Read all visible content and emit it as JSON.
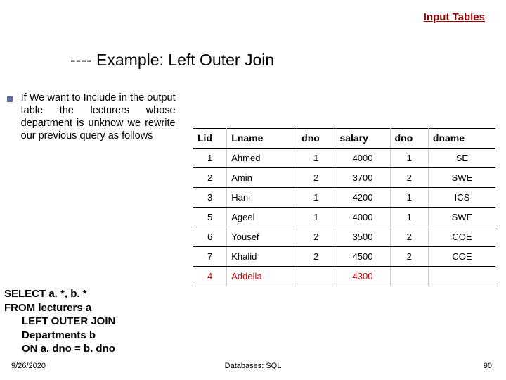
{
  "link": "Input Tables",
  "title": "---- Example: Left Outer Join",
  "bullet": "If We want to Include in the output table the lecturers whose department is unknow we rewrite our previous query as follows",
  "sql": "SELECT a. *, b. *\nFROM lecturers a\n      LEFT OUTER JOIN\n      Departments b\n      ON a. dno = b. dno",
  "table": {
    "headers": [
      "Lid",
      "Lname",
      "dno",
      "salary",
      "dno",
      "dname"
    ],
    "rows": [
      {
        "lid": "1",
        "lname": "Ahmed",
        "dno1": "1",
        "salary": "4000",
        "dno2": "1",
        "dname": "SE",
        "red": false
      },
      {
        "lid": "2",
        "lname": "Amin",
        "dno1": "2",
        "salary": "3700",
        "dno2": "2",
        "dname": "SWE",
        "red": false
      },
      {
        "lid": "3",
        "lname": "Hani",
        "dno1": "1",
        "salary": "4200",
        "dno2": "1",
        "dname": "ICS",
        "red": false
      },
      {
        "lid": "5",
        "lname": "Ageel",
        "dno1": "1",
        "salary": "4000",
        "dno2": "1",
        "dname": "SWE",
        "red": false
      },
      {
        "lid": "6",
        "lname": "Yousef",
        "dno1": "2",
        "salary": "3500",
        "dno2": "2",
        "dname": "COE",
        "red": false
      },
      {
        "lid": "7",
        "lname": "Khalid",
        "dno1": "2",
        "salary": "4500",
        "dno2": "2",
        "dname": "COE",
        "red": false
      },
      {
        "lid": "4",
        "lname": "Addella",
        "dno1": "",
        "salary": "4300",
        "dno2": "",
        "dname": "",
        "red": true
      }
    ]
  },
  "footer": {
    "date": "9/26/2020",
    "center": "Databases: SQL",
    "page": "90"
  }
}
